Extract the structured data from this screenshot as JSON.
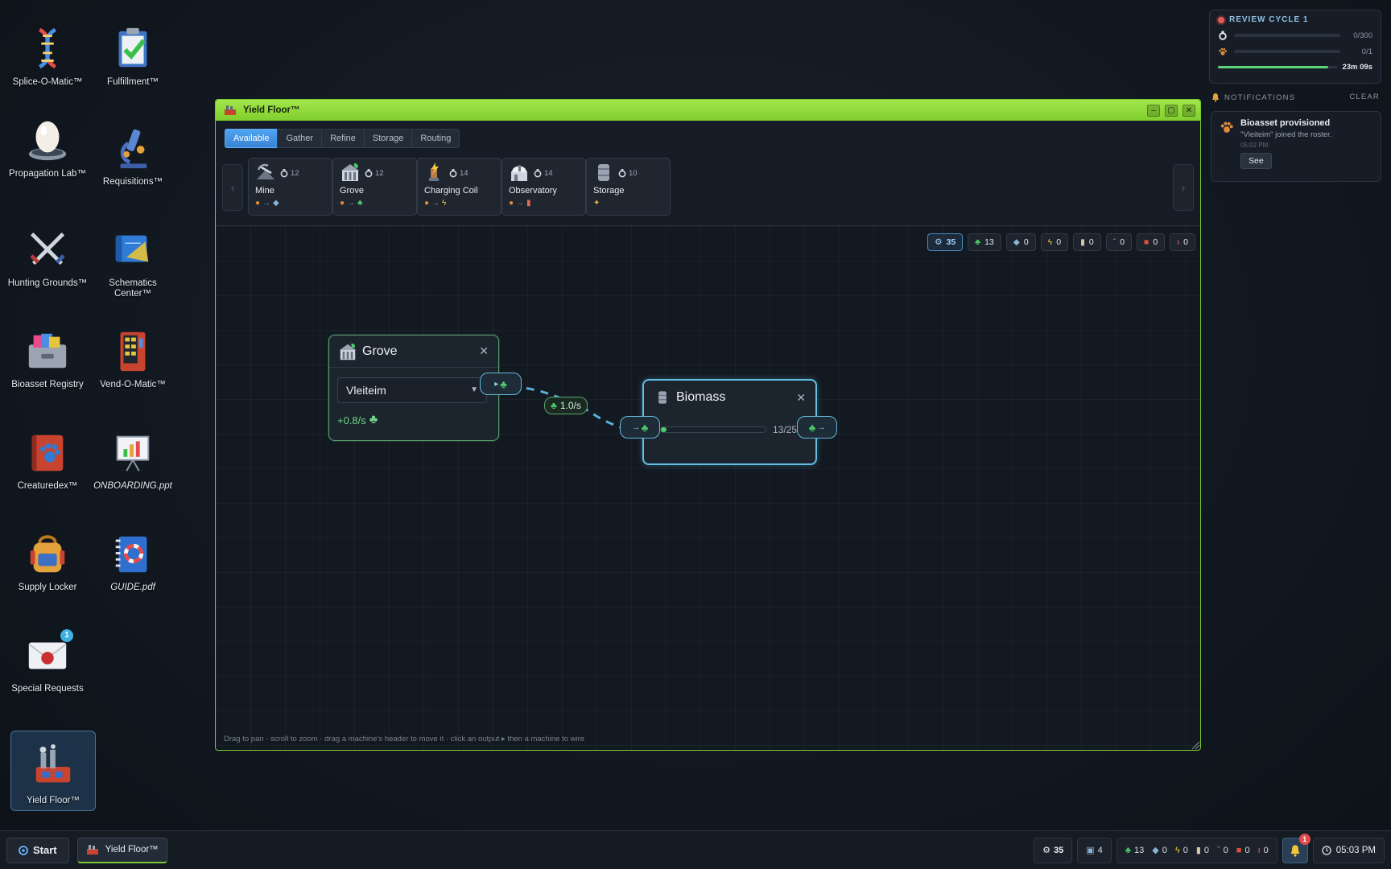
{
  "desktop": {
    "icons": [
      {
        "label": "Splice-O-Matic™",
        "icon": "dna-icon"
      },
      {
        "label": "Fulfillment™",
        "icon": "clipboard-check-icon"
      },
      {
        "label": "Propagation Lab™",
        "icon": "egg-incubator-icon"
      },
      {
        "label": "Requisitions™",
        "icon": "microscope-icon"
      },
      {
        "label": "Hunting Grounds™",
        "icon": "crossed-swords-icon"
      },
      {
        "label": "Schematics Center™",
        "icon": "blueprint-icon"
      },
      {
        "label": "Bioasset Registry",
        "icon": "file-drawer-icon"
      },
      {
        "label": "Vend-O-Matic™",
        "icon": "vending-machine-icon"
      },
      {
        "label": "Creaturedex™",
        "icon": "paw-book-icon"
      },
      {
        "label": "ONBOARDING.ppt",
        "icon": "presentation-icon"
      },
      {
        "label": "Supply Locker",
        "icon": "backpack-icon"
      },
      {
        "label": "GUIDE.pdf",
        "icon": "guide-book-icon"
      },
      {
        "label": "Special Requests",
        "icon": "sealed-envelope-icon",
        "badge": "1"
      },
      {
        "label": "Yield Floor™",
        "icon": "factory-icon"
      }
    ]
  },
  "review": {
    "title": "REVIEW CYCLE 1",
    "row1_value": "0/300",
    "row2_value": "0/1",
    "timer": "23m 09s",
    "timer_progress": 0.92
  },
  "notifications": {
    "header": "NOTIFICATIONS",
    "clear_label": "CLEAR",
    "items": [
      {
        "title": "Bioasset provisioned",
        "detail": "\"Vleiteim\" joined the roster.",
        "time": "05:02 PM",
        "action": "See"
      }
    ]
  },
  "window": {
    "title": "Yield Floor™",
    "controls": {
      "minimize": "–",
      "maximize": "▢",
      "close": "✕"
    },
    "tabs": [
      "Available",
      "Gather",
      "Refine",
      "Storage",
      "Routing"
    ],
    "active_tab": "Available",
    "palette": {
      "prev": "‹",
      "next": "›",
      "machines": [
        {
          "name": "Mine",
          "cost": "12",
          "icon": "mine-icon"
        },
        {
          "name": "Grove",
          "cost": "12",
          "icon": "grove-icon"
        },
        {
          "name": "Charging Coil",
          "cost": "14",
          "icon": "charging-coil-icon"
        },
        {
          "name": "Observatory",
          "cost": "14",
          "icon": "observatory-icon"
        },
        {
          "name": "Storage",
          "cost": "10",
          "icon": "storage-barrel-icon"
        }
      ]
    },
    "resources": [
      {
        "icon": "gear-ring-icon",
        "value": "35",
        "highlight": true
      },
      {
        "icon": "leaf-icon",
        "value": "13"
      },
      {
        "icon": "ore-icon",
        "value": "0"
      },
      {
        "icon": "bolt-icon",
        "value": "0"
      },
      {
        "icon": "jar-icon",
        "value": "0"
      },
      {
        "icon": "sprout-icon",
        "value": "0"
      },
      {
        "icon": "red-canister-icon",
        "value": "0"
      },
      {
        "icon": "vial-icon",
        "value": "0"
      }
    ],
    "nodes": {
      "grove": {
        "title": "Grove",
        "close": "✕",
        "selected": "Vleiteim",
        "rate": "+0.8/s"
      },
      "link": {
        "rate": "1.0/s"
      },
      "biomass": {
        "title": "Biomass",
        "close": "✕",
        "capacity": "13/250",
        "fill": 0.052
      }
    },
    "hint": "Drag to pan · scroll to zoom · drag a machine's header to move it · click an output ▸ then a machine to wire"
  },
  "taskbar": {
    "start_label": "Start",
    "task_label": "Yield Floor™",
    "tray": [
      {
        "icon": "gear-ring-icon",
        "value": "35",
        "bold": true
      },
      {
        "icon": "floppy-icon",
        "value": "4"
      }
    ],
    "tray_resources": [
      {
        "icon": "leaf-icon",
        "value": "13"
      },
      {
        "icon": "ore-icon",
        "value": "0"
      },
      {
        "icon": "bolt-icon",
        "value": "0"
      },
      {
        "icon": "jar-icon",
        "value": "0"
      },
      {
        "icon": "sprout-icon",
        "value": "0"
      },
      {
        "icon": "red-canister-icon",
        "value": "0"
      },
      {
        "icon": "vial-icon",
        "value": "0"
      }
    ],
    "notification_count": "1",
    "clock": "05:03 PM"
  }
}
